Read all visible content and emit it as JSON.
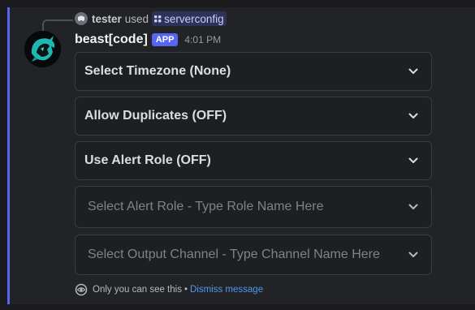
{
  "reply": {
    "user": "tester",
    "action": "used",
    "command": "serverconfig"
  },
  "message": {
    "bot_name": "beast[code]",
    "app_tag": "APP",
    "timestamp": "4:01 PM"
  },
  "selects": [
    {
      "label": "Select Timezone (None)",
      "placeholder": false
    },
    {
      "label": "Allow Duplicates (OFF)",
      "placeholder": false
    },
    {
      "label": "Use Alert Role (OFF)",
      "placeholder": false
    },
    {
      "label": "Select Alert Role - Type Role Name Here",
      "placeholder": true
    },
    {
      "label": "Select Output Channel - Type Channel Name Here",
      "placeholder": true
    }
  ],
  "ephemeral": {
    "text": "Only you can see this",
    "separator": "•",
    "dismiss": "Dismiss message"
  },
  "colors": {
    "accent": "#5865f2",
    "link": "#5197ed",
    "background": "#222327"
  },
  "icons": [
    "reply-avatar-icon",
    "slash-command-icon",
    "bot-avatar",
    "chevron-down-icon",
    "eye-icon"
  ]
}
